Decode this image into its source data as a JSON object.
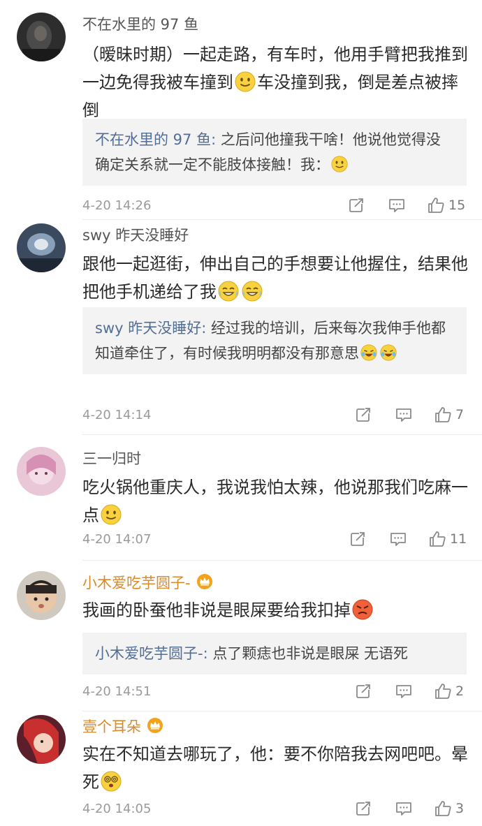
{
  "comments": [
    {
      "username": "不在水里的 97 鱼",
      "text_parts": [
        "（暧昧时期）一起走路，有车时，他用手臂把我推到一边免得我被车撞到",
        "车没撞到我，倒是差点被摔倒"
      ],
      "reply": {
        "name": "不在水里的 97 鱼",
        "text": "之后问他撞我干啥！他说他觉得没确定关系就一定不能肢体接触！我："
      },
      "time": "4-20 14:26",
      "likes": "15"
    },
    {
      "username": "swy 昨天没睡好",
      "text": "跟他一起逛街，伸出自己的手想要让他握住，结果他把他手机递给了我",
      "reply": {
        "name": "swy 昨天没睡好",
        "text": "经过我的培训，后来每次我伸手他都知道牵住了，有时候我明明都没有那意思"
      },
      "time": "4-20 14:14",
      "likes": "7"
    },
    {
      "username": "三一归时",
      "text": "吃火锅他重庆人，我说我怕太辣，他说那我们吃麻一点",
      "time": "4-20 14:07",
      "likes": "11"
    },
    {
      "username": "小木爱吃芋圆子-",
      "text": "我画的卧蚕他非说是眼屎要给我扣掉",
      "reply": {
        "name": "小木爱吃芋圆子-",
        "text": "点了颗痣也非说是眼屎 无语死"
      },
      "time": "4-20 14:51",
      "likes": "2"
    },
    {
      "username": "壹个耳朵",
      "text": "实在不知道去哪玩了，他：要不你陪我去网吧吧。晕死",
      "time": "4-20 14:05",
      "likes": "3"
    }
  ],
  "reply_separator": ": ",
  "icons": [
    "repost-icon",
    "comment-icon",
    "like-icon",
    "crown-icon",
    "smile-emoji",
    "grin-tears-emoji",
    "laugh-cry-emoji",
    "angry-emoji",
    "dizzy-emoji"
  ],
  "colors": {
    "username_gold": "#d98a2b",
    "reply_name": "#536e96",
    "reply_bg": "#f3f3f3",
    "meta": "#9a9a9a"
  }
}
